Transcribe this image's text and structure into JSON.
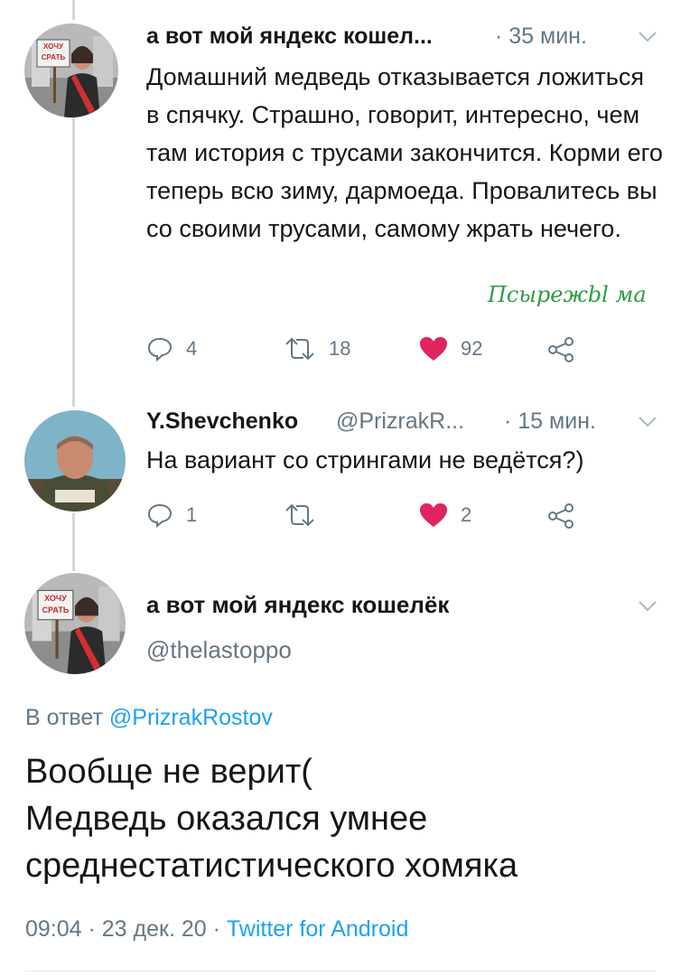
{
  "tweet1": {
    "name": "а вот мой яндекс кошел...",
    "time": "· 35 мин.",
    "avatar_sign": "ХОЧУ СРАТЬ",
    "text": "Домашний медведь отказывается ложиться в спячку. Страшно, говорит, интересно, чем там история с трусами закончится. Корми его теперь всю зиму, дармоеда. Провалитесь вы со своими трусами, самому жрать нечего.",
    "watermark": "Псырежbl ма",
    "replies": "4",
    "retweets": "18",
    "likes": "92"
  },
  "tweet2": {
    "name": "Y.Shevchenko",
    "handle": "@PrizrakR...",
    "time": "· 15 мин.",
    "text": "На вариант со стрингами не ведётся?)",
    "replies": "1",
    "retweets": "",
    "likes": "2"
  },
  "main_tweet": {
    "name": "а вот мой яндекс кошелёк",
    "handle": "@thelastoppo",
    "avatar_sign": "ХОЧУ СРАТЬ",
    "reply_prefix": "В ответ",
    "reply_to": "@PrizrakRostov",
    "text_lines": [
      "Вообще не верит(",
      "Медведь оказался умнее",
      "среднестатистического хомяка"
    ],
    "timestamp": "09:04 · 23 дек. 20 ·",
    "source": "Twitter for Android"
  },
  "colors": {
    "like": "#e0245e",
    "link": "#1da1f2",
    "muted": "#657786",
    "thread": "#cfd9de",
    "watermark": "#2e9b46"
  }
}
